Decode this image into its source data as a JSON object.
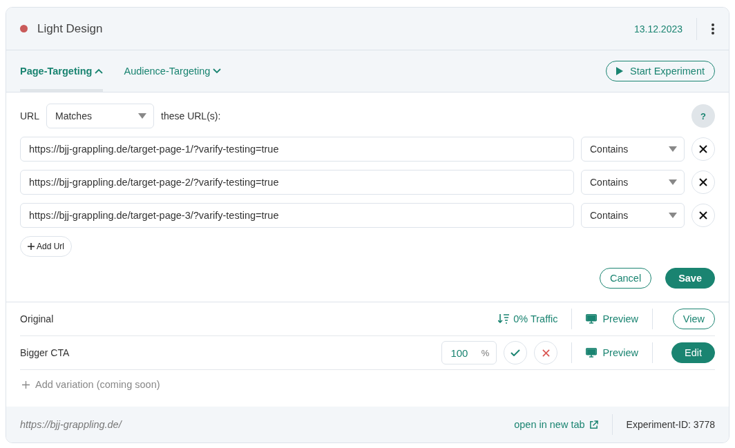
{
  "experiment": {
    "name": "Light Design",
    "date": "13.12.2023"
  },
  "tabs": [
    {
      "label": "Page-Targeting",
      "selected": true,
      "expanded": true
    },
    {
      "label": "Audience-Targeting",
      "selected": false,
      "expanded": false
    }
  ],
  "start_button": "Start Experiment",
  "targeting": {
    "label": "URL",
    "match_mode": "Matches",
    "suffix": "these URL(s):",
    "help": "?",
    "urls": [
      {
        "value": "https://bjj-grappling.de/target-page-1/?varify-testing=true",
        "mode": "Contains"
      },
      {
        "value": "https://bjj-grappling.de/target-page-2/?varify-testing=true",
        "mode": "Contains"
      },
      {
        "value": "https://bjj-grappling.de/target-page-3/?varify-testing=true",
        "mode": "Contains"
      }
    ],
    "add_url": "Add Url",
    "cancel": "Cancel",
    "save": "Save"
  },
  "variations": [
    {
      "name": "Original",
      "kind": "original",
      "traffic": "0% Traffic",
      "preview": "Preview",
      "action": "View"
    },
    {
      "name": "Bigger CTA",
      "kind": "editing",
      "percent_value": "100",
      "percent_unit": "%",
      "preview": "Preview",
      "action": "Edit"
    }
  ],
  "add_variation": "Add variation (coming soon)",
  "footer": {
    "url": "https://bjj-grappling.de/",
    "open_link": "open in new tab",
    "experiment_id": "Experiment-ID: 3778"
  }
}
